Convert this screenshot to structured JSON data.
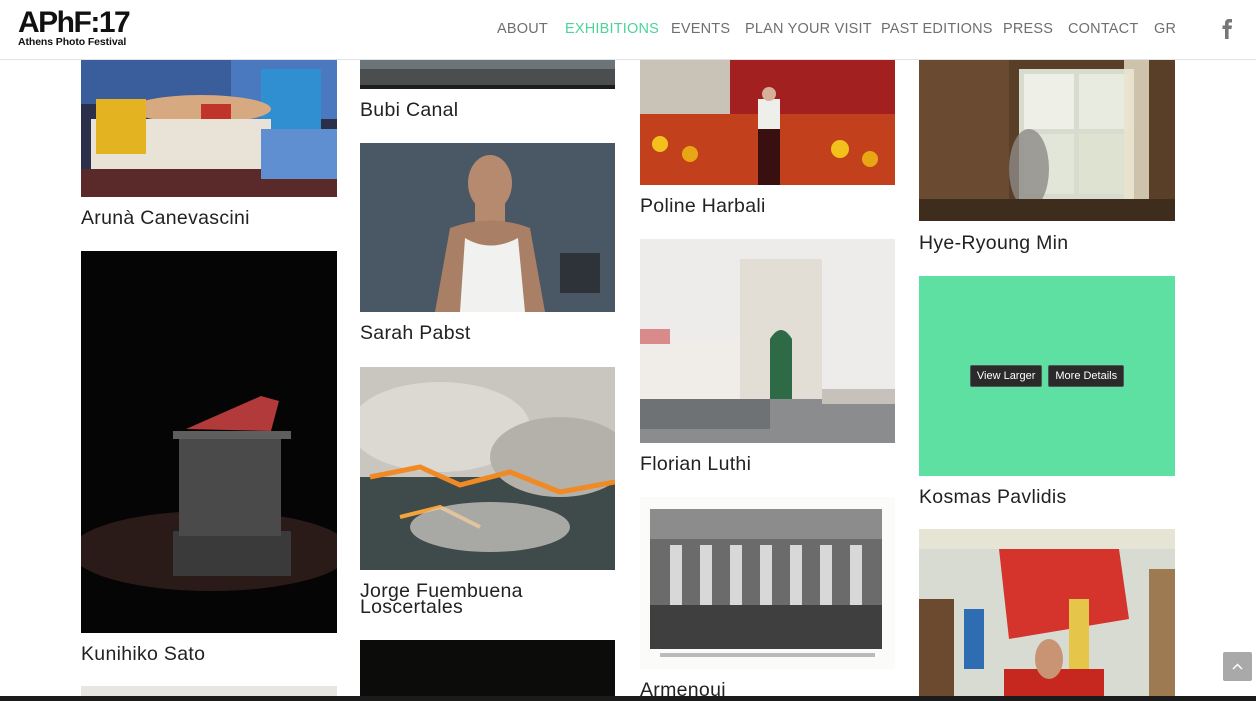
{
  "logo": {
    "main": "APhF:17",
    "sub": "Athens Photo Festival"
  },
  "nav": {
    "items": [
      "ABOUT",
      "EXHIBITIONS",
      "EVENTS",
      "PLAN YOUR VISIT",
      "PAST EDITIONS",
      "PRESS",
      "CONTACT",
      "GR"
    ],
    "active": "EXHIBITIONS"
  },
  "colors": {
    "accent": "#4dd39a",
    "overlay": "#5de0a2"
  },
  "social": [
    "facebook-icon"
  ],
  "portfolio": {
    "columns": [
      [
        "Arunà Canevascini",
        "Kunihiko Sato"
      ],
      [
        "Bubi Canal",
        "Sarah Pabst",
        "Jorge Fuembuena Loscertales"
      ],
      [
        "Poline Harbali",
        "Florian Luthi",
        "Armenoui"
      ],
      [
        "Hye-Ryoung Min",
        "Kosmas Pavlidis"
      ]
    ],
    "overlay_buttons": {
      "view": "View Larger",
      "details": "More Details"
    }
  }
}
